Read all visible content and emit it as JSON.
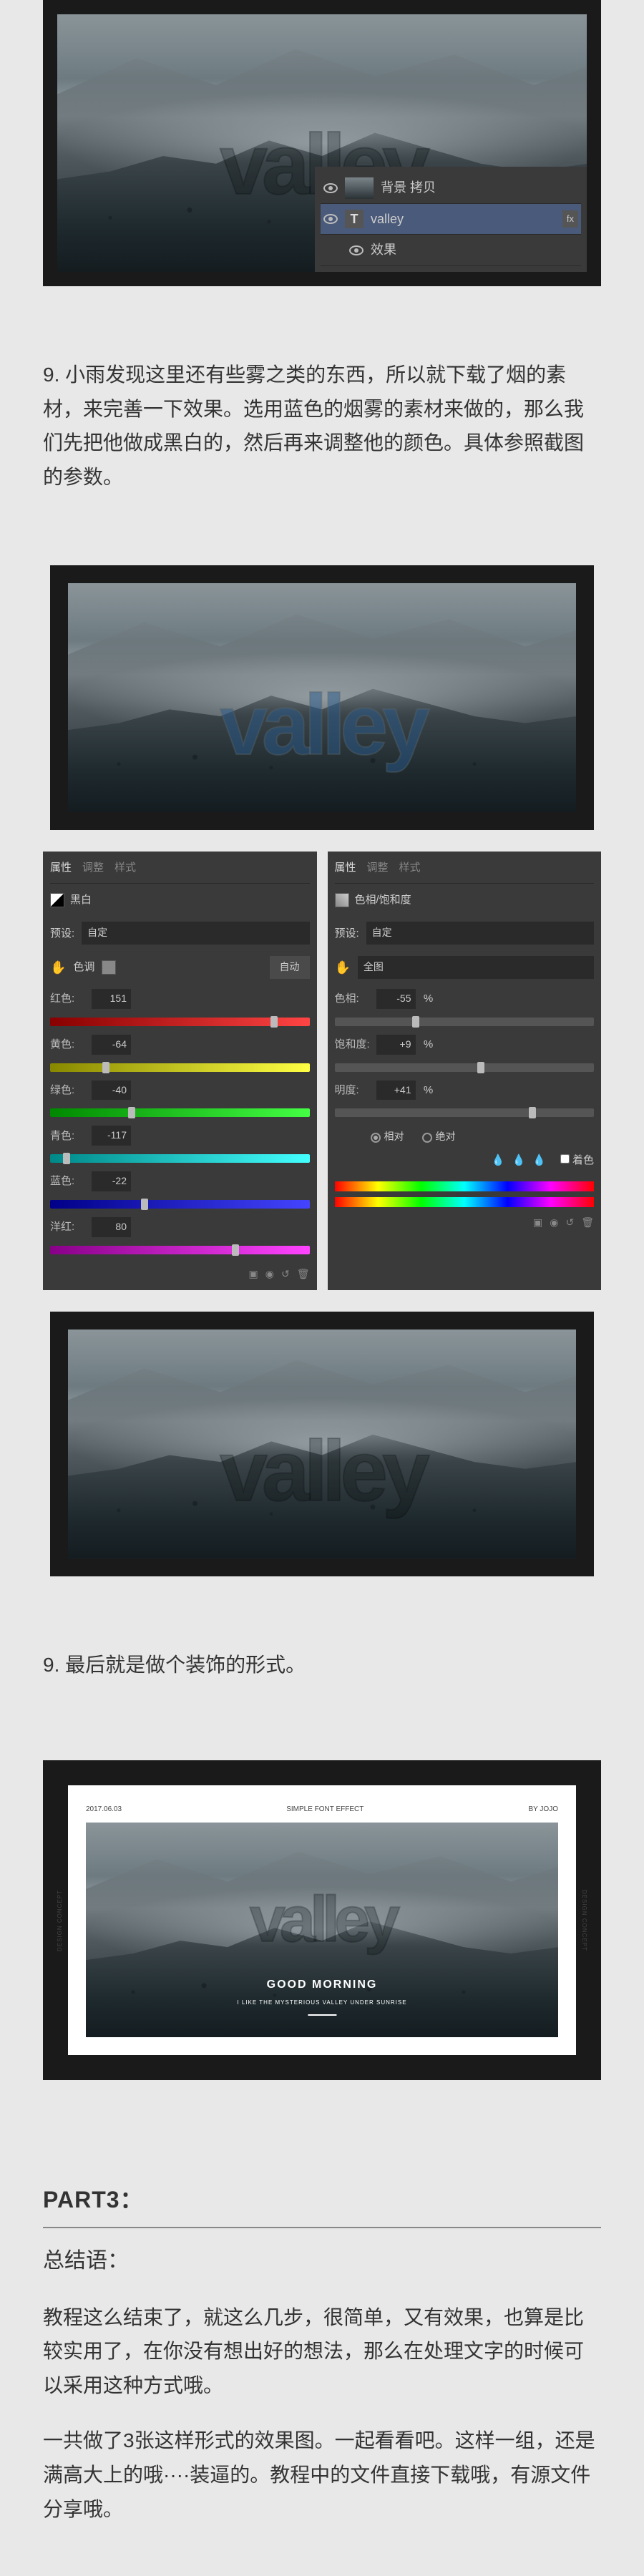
{
  "step9a": {
    "text": "9. 小雨发现这里还有些雾之类的东西，所以就下载了烟的素材，来完善一下效果。选用蓝色的烟雾的素材来做的，那么我们先把他做成黑白的，然后再来调整他的颜色。具体参照截图的参数。"
  },
  "valley_word": "valley",
  "layers": {
    "row1": "背景 拷贝",
    "row2": "valley",
    "row3": "效果",
    "fx_badge": "fx"
  },
  "bw_panel": {
    "tab1": "属性",
    "tab2": "调整",
    "tab3": "样式",
    "title": "黑白",
    "preset_label": "预设:",
    "preset_value": "自定",
    "auto": "自动",
    "tint_label": "色调",
    "rows": [
      {
        "label": "红色:",
        "val": "151",
        "grad": "linear-gradient(90deg,#800,#f44)",
        "pos": "85%"
      },
      {
        "label": "黄色:",
        "val": "-64",
        "grad": "linear-gradient(90deg,#880,#ff4)",
        "pos": "20%"
      },
      {
        "label": "绿色:",
        "val": "-40",
        "grad": "linear-gradient(90deg,#080,#4f4)",
        "pos": "30%"
      },
      {
        "label": "青色:",
        "val": "-117",
        "grad": "linear-gradient(90deg,#088,#4ff)",
        "pos": "5%"
      },
      {
        "label": "蓝色:",
        "val": "-22",
        "grad": "linear-gradient(90deg,#008,#44f)",
        "pos": "35%"
      },
      {
        "label": "洋红:",
        "val": "80",
        "grad": "linear-gradient(90deg,#808,#f4f)",
        "pos": "70%"
      }
    ]
  },
  "hsl_panel": {
    "tab1": "属性",
    "tab2": "调整",
    "tab3": "样式",
    "title": "色相/饱和度",
    "preset_label": "预设:",
    "preset_value": "自定",
    "master": "全图",
    "rows": [
      {
        "label": "色相:",
        "val": "-55",
        "grad": "linear-gradient(90deg,#555,#555)",
        "pos": "30%"
      },
      {
        "label": "饱和度:",
        "val": "+9",
        "grad": "linear-gradient(90deg,#555,#555)",
        "pos": "55%"
      },
      {
        "label": "明度:",
        "val": "+41",
        "grad": "linear-gradient(90deg,#555,#555)",
        "pos": "75%"
      }
    ],
    "colorize": "着色",
    "radio_a": "相对",
    "radio_b": "绝对"
  },
  "step9b": {
    "text": "9. 最后就是做个装饰的形式。"
  },
  "final": {
    "date": "2017.06.03",
    "center": "SIMPLE FONT EFFECT",
    "by": "BY JOJO",
    "side": "DESIGN CONCEPT",
    "gm": "GOOD MORNING",
    "gm_sub": "I LIKE THE MYSTERIOUS VALLEY UNDER SUNRISE"
  },
  "part3": {
    "heading": "PART3：",
    "label": "总结语：",
    "p1": "教程这么结束了，就这么几步，很简单，又有效果，也算是比较实用了，在你没有想出好的想法，那么在处理文字的时候可以采用这种方式哦。",
    "p2": "一共做了3张这样形式的效果图。一起看看吧。这样一组，还是满高大上的哦····装逼的。教程中的文件直接下载哦，有源文件分享哦。"
  }
}
